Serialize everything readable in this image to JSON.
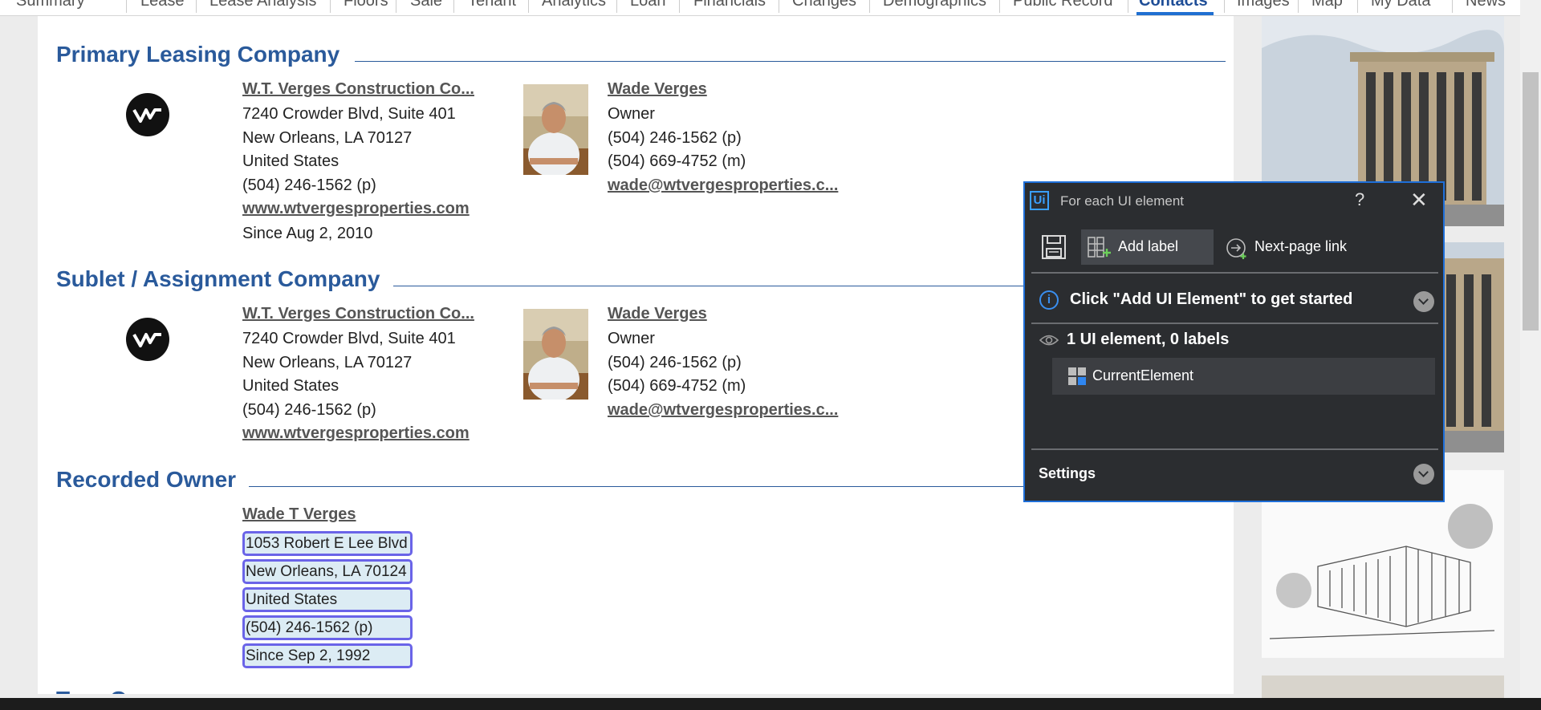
{
  "nav": {
    "tabs": [
      "Summary",
      "Lease",
      "Lease Analysis",
      "Floors",
      "Sale",
      "Tenant",
      "Analytics",
      "Loan",
      "Financials",
      "Changes",
      "Demographics",
      "Public Record",
      "Contacts",
      "Images",
      "Map",
      "My Data",
      "News"
    ],
    "active": "Contacts"
  },
  "sections": {
    "primary": {
      "title": "Primary Leasing Company",
      "company": {
        "name": "W.T. Verges Construction Co...",
        "address": "7240 Crowder Blvd, Suite 401",
        "city": "New Orleans, LA 70127",
        "country": "United States",
        "phone": "(504) 246-1562 (p)",
        "website": "www.wtvergesproperties.com",
        "since": "Since Aug 2, 2010"
      },
      "contact": {
        "name": "Wade Verges",
        "role": "Owner",
        "phone": "(504) 246-1562 (p)",
        "mobile": "(504) 669-4752 (m)",
        "email": "wade@wtvergesproperties.c..."
      }
    },
    "sublet": {
      "title": "Sublet / Assignment Company",
      "company": {
        "name": "W.T. Verges Construction Co...",
        "address": "7240 Crowder Blvd, Suite 401",
        "city": "New Orleans, LA 70127",
        "country": "United States",
        "phone": "(504) 246-1562 (p)",
        "website": "www.wtvergesproperties.com"
      },
      "contact": {
        "name": "Wade Verges",
        "role": "Owner",
        "phone": "(504) 246-1562 (p)",
        "mobile": "(504) 669-4752 (m)",
        "email": "wade@wtvergesproperties.c..."
      }
    },
    "owner": {
      "title": "Recorded Owner",
      "name": "Wade T Verges",
      "address": "1053 Robert E Lee Blvd",
      "city": "New Orleans, LA 70124",
      "country": "United States",
      "phone": "(504) 246-1562 (p)",
      "since": "Since Sep 2, 1992"
    },
    "next_title": "True Owner"
  },
  "overlay": {
    "title": "For each UI element",
    "help": "?",
    "close": "✕",
    "add_label": "Add label",
    "next_page": "Next-page link",
    "info": "Click \"Add UI Element\" to get started",
    "summary": "1 UI element, 0 labels",
    "element": "CurrentElement",
    "settings": "Settings",
    "accent": "#1e6fd9"
  },
  "colors": {
    "section_title": "#2a5a9b",
    "highlight_border": "#6a64e8",
    "highlight_fill": "#dcecf4"
  }
}
